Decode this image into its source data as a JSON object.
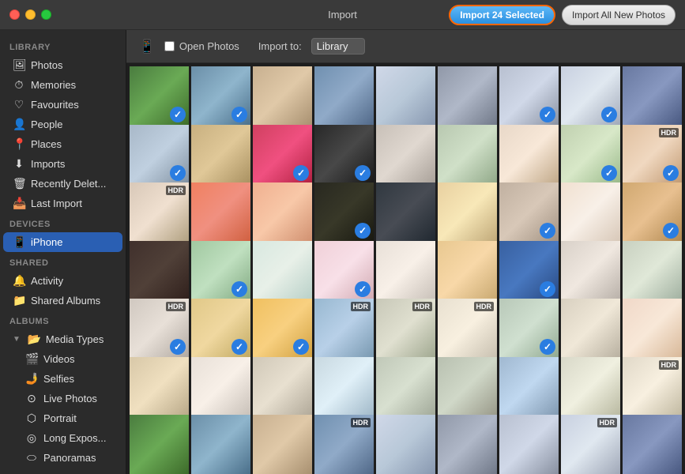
{
  "titlebar": {
    "title": "Import",
    "import_selected_label": "Import 24 Selected",
    "import_all_label": "Import All New Photos"
  },
  "toolbar": {
    "device_label": "Open Photos",
    "import_to_label": "Import to:",
    "import_to_value": "Library"
  },
  "sidebar": {
    "library_header": "Library",
    "devices_header": "Devices",
    "shared_header": "Shared",
    "albums_header": "Albums",
    "library_items": [
      {
        "icon": "🖼",
        "label": "Photos"
      },
      {
        "icon": "⏱",
        "label": "Memories"
      },
      {
        "icon": "♡",
        "label": "Favourites"
      },
      {
        "icon": "👤",
        "label": "People"
      },
      {
        "icon": "📍",
        "label": "Places"
      },
      {
        "icon": "⬇",
        "label": "Imports"
      },
      {
        "icon": "🗑",
        "label": "Recently Delet..."
      },
      {
        "icon": "📥",
        "label": "Last Import"
      }
    ],
    "devices_items": [
      {
        "icon": "📱",
        "label": "iPhone",
        "active": true
      }
    ],
    "shared_items": [
      {
        "icon": "🔔",
        "label": "Activity"
      },
      {
        "icon": "📁",
        "label": "Shared Albums"
      }
    ],
    "albums_items": [
      {
        "label": "Media Types",
        "expanded": true
      },
      {
        "label": "Videos",
        "sub": true
      },
      {
        "label": "Selfies",
        "sub": true
      },
      {
        "label": "Live Photos",
        "sub": true
      },
      {
        "label": "Portrait",
        "sub": true
      },
      {
        "label": "Long Expos...",
        "sub": true
      },
      {
        "label": "Panoramas",
        "sub": true
      }
    ]
  },
  "photos": [
    {
      "color": "c1",
      "checked": true,
      "badge": ""
    },
    {
      "color": "c2",
      "checked": true,
      "badge": ""
    },
    {
      "color": "c3",
      "checked": false,
      "badge": ""
    },
    {
      "color": "c4",
      "checked": false,
      "badge": ""
    },
    {
      "color": "c5",
      "checked": false,
      "badge": ""
    },
    {
      "color": "c6",
      "checked": false,
      "badge": ""
    },
    {
      "color": "c7",
      "checked": true,
      "badge": ""
    },
    {
      "color": "c8",
      "checked": true,
      "badge": ""
    },
    {
      "color": "c9",
      "checked": false,
      "badge": ""
    },
    {
      "color": "c10",
      "checked": true,
      "badge": ""
    },
    {
      "color": "c11",
      "checked": false,
      "badge": ""
    },
    {
      "color": "c12",
      "checked": true,
      "badge": ""
    },
    {
      "color": "c13",
      "checked": true,
      "badge": ""
    },
    {
      "color": "c14",
      "checked": false,
      "badge": ""
    },
    {
      "color": "c15",
      "checked": false,
      "badge": ""
    },
    {
      "color": "c16",
      "checked": false,
      "badge": ""
    },
    {
      "color": "c17",
      "checked": true,
      "badge": ""
    },
    {
      "color": "c18",
      "checked": true,
      "badge": "HDR"
    },
    {
      "color": "c19",
      "checked": false,
      "badge": "HDR"
    },
    {
      "color": "c20",
      "checked": false,
      "badge": ""
    },
    {
      "color": "c21",
      "checked": false,
      "badge": ""
    },
    {
      "color": "c22",
      "checked": true,
      "badge": ""
    },
    {
      "color": "c23",
      "checked": false,
      "badge": ""
    },
    {
      "color": "c24",
      "checked": false,
      "badge": ""
    },
    {
      "color": "c25",
      "checked": true,
      "badge": ""
    },
    {
      "color": "c26",
      "checked": false,
      "badge": ""
    },
    {
      "color": "c27",
      "checked": true,
      "badge": ""
    },
    {
      "color": "c28",
      "checked": false,
      "badge": ""
    },
    {
      "color": "c29",
      "checked": true,
      "badge": ""
    },
    {
      "color": "c30",
      "checked": false,
      "badge": ""
    },
    {
      "color": "c31",
      "checked": true,
      "badge": ""
    },
    {
      "color": "c32",
      "checked": false,
      "badge": ""
    },
    {
      "color": "c33",
      "checked": false,
      "badge": ""
    },
    {
      "color": "c34",
      "checked": true,
      "badge": ""
    },
    {
      "color": "c35",
      "checked": false,
      "badge": ""
    },
    {
      "color": "c36",
      "checked": false,
      "badge": ""
    },
    {
      "color": "c37",
      "checked": true,
      "badge": "HDR"
    },
    {
      "color": "c38",
      "checked": true,
      "badge": ""
    },
    {
      "color": "c39",
      "checked": true,
      "badge": ""
    },
    {
      "color": "c40",
      "checked": false,
      "badge": "HDR"
    },
    {
      "color": "c41",
      "checked": false,
      "badge": "HDR"
    },
    {
      "color": "c42",
      "checked": false,
      "badge": "HDR"
    },
    {
      "color": "c43",
      "checked": true,
      "badge": ""
    },
    {
      "color": "c44",
      "checked": false,
      "badge": ""
    },
    {
      "color": "c45",
      "checked": false,
      "badge": ""
    },
    {
      "color": "c46",
      "checked": false,
      "badge": ""
    },
    {
      "color": "c47",
      "checked": false,
      "badge": ""
    },
    {
      "color": "c48",
      "checked": false,
      "badge": ""
    },
    {
      "color": "c49",
      "checked": false,
      "badge": ""
    },
    {
      "color": "c50",
      "checked": false,
      "badge": ""
    },
    {
      "color": "c51",
      "checked": false,
      "badge": ""
    },
    {
      "color": "c52",
      "checked": false,
      "badge": ""
    },
    {
      "color": "c53",
      "checked": false,
      "badge": ""
    },
    {
      "color": "c54",
      "checked": false,
      "badge": "HDR"
    },
    {
      "color": "c1",
      "checked": false,
      "badge": ""
    },
    {
      "color": "c2",
      "checked": false,
      "badge": ""
    },
    {
      "color": "c3",
      "checked": false,
      "badge": ""
    },
    {
      "color": "c4",
      "checked": false,
      "badge": "HDR"
    },
    {
      "color": "c5",
      "checked": false,
      "badge": ""
    },
    {
      "color": "c6",
      "checked": false,
      "badge": ""
    },
    {
      "color": "c7",
      "checked": false,
      "badge": ""
    },
    {
      "color": "c8",
      "checked": false,
      "badge": "HDR"
    },
    {
      "color": "c9",
      "checked": false,
      "badge": ""
    }
  ]
}
